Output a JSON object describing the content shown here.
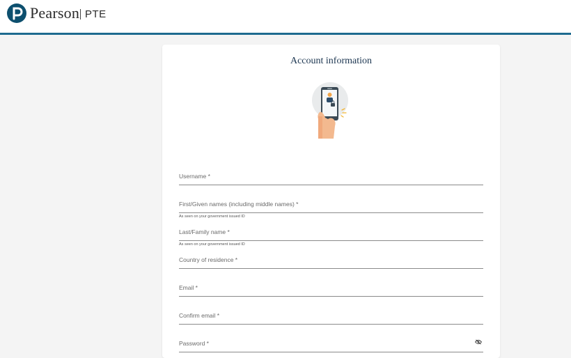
{
  "header": {
    "brand": "Pearson",
    "product": "PTE"
  },
  "form": {
    "title": "Account information",
    "fields": [
      {
        "label": "Username *"
      },
      {
        "label": "First/Given names (including middle names) *",
        "hint": "As seen on your government issued ID"
      },
      {
        "label": "Last/Family name *",
        "hint": "As seen on your government issued ID"
      },
      {
        "label": "Country of residence *"
      },
      {
        "label": "Email *"
      },
      {
        "label": "Confirm email *"
      },
      {
        "label": "Password *"
      }
    ]
  },
  "colors": {
    "brand_blue": "#0d4f6e",
    "header_border": "#1e6b8f",
    "title": "#1b3550"
  }
}
